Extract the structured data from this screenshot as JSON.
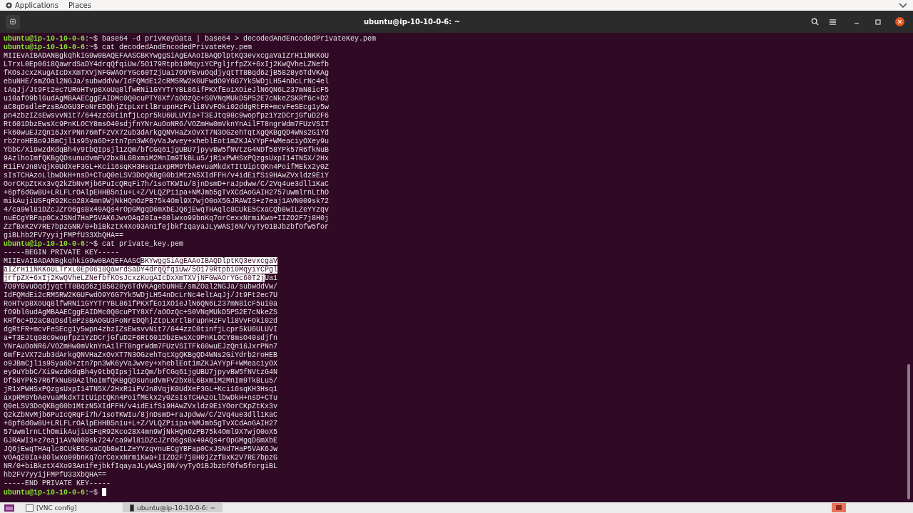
{
  "top_bar": {
    "menus": [
      "Applications",
      "Places"
    ]
  },
  "terminal": {
    "title": "ubuntu@ip-10-10-0-6: ~",
    "lines": [
      {
        "kind": "prompt",
        "user": "ubuntu@ip-10-10-0-6",
        "path": ":~$",
        "command": "base64 -d privKeyData | base64 > decodedAndEncodedPrivateKey.pem"
      },
      {
        "kind": "prompt",
        "user": "ubuntu@ip-10-10-0-6",
        "path": ":~$",
        "command": "cat decodedAndEncodedPrivateKey.pem"
      },
      {
        "kind": "output",
        "text": "MIIEvAIBADANBgkqhkiG9w0BAQEFAASCBKYwggSiAgEAAoIBAQDlptKQ3evxcgaVaIZrH1iNKKoU"
      },
      {
        "kind": "output",
        "text": "LTrxL0Ep0618QawrdSaDY4drqQfqiUw/5O179Rtpb10MqyiYCPgljrfpZX+6xIj2KwQVheLZNefb"
      },
      {
        "kind": "output",
        "text": "fKOsJcxzKugAIcDxXmTXVjNFGWAOrYGc60T2jUa17O9YBvuOqdjyqtTT8Bqd6zjB5828y6TdVKAg"
      },
      {
        "kind": "output",
        "text": "ebuNHE/smZOal2NGJa/subwddVw/IdFQMdEi2cRM5RW2KGUFwdO9Y6G7Yk5WDjLH54nDcLrNc4el"
      },
      {
        "kind": "output",
        "text": "tAqJj/Jt9Ft2ec7URoHTvp8XoUq8lfwRNi1GYYTrYBL86ifPKXfEo1XOieJlN6QN6L237mN8icF5"
      },
      {
        "kind": "output",
        "text": "ui0afO9blGudAgMBAAECggEAIDMc0Q0cuPTY8Xf/aOOzQc+S0VNqMUkD5P52E7cNkeZSKRf6c+D2"
      },
      {
        "kind": "output",
        "text": "aC8qDsdlePzsBAOGU3FoNrEDQhjZtpLxrtlBrupnHzFvli8VvFOki02ddgRtFR+mcvFeSEcg1y5w"
      },
      {
        "kind": "output",
        "text": "pn4zbzIZsEwsvvNit7/644zzC0tinfjLcpr5kU6ULUVIa+T3EJtq98c9wopfpz1YzDCrjGfuD2F6"
      },
      {
        "kind": "output",
        "text": "Rt601DbzEwsXc9PnKLOCY8msO40sdjfnYNrAuOoNR6/VOZmHw0mVknYnAilFT8ngrWdm7FUzVSIT"
      },
      {
        "kind": "output",
        "text": "Fk60wuEJzQn16JxrPNn76mfFzVX72ub3dArkgQNVHaZxOvXT7N3OGzehTqtXgQKBgQD4WNs2GiYd"
      },
      {
        "kind": "output",
        "text": "rb2roHEBo9JBmCjl1s95ya6D+ztn7pn3WK6yVaJwvey+xheblEot1mZKJAYYpF+WMeaciyOXey9u"
      },
      {
        "kind": "output",
        "text": "YbbC/Xi9wzdKdqBh4y9tbQIpsjl1zQm/bfCGq61jgUBU7jpyvBW5fNVtzG4NDf58YPk57R6fkNuB"
      },
      {
        "kind": "output",
        "text": "9AzlhoImfQKBgQDsunudvmFV2bx8L6BxmiM2MnIm9TkBLu5/jR1xPWHSxPQzgsUxpI14TN5X/2Hx"
      },
      {
        "kind": "output",
        "text": "R1iFVJn8VqjK0UdXeF3GL+Kci16sqKH3Hsq1axpRM9YbAevuaMkdxTItUiptQKn4PoifMEkx2y0Z"
      },
      {
        "kind": "output",
        "text": "sIsTCHAzoLlbwDkH+nsD+CTuQ0eLSV3DoQKBgG0b1MtzN5XIdFFH/v4idEifSi9HAwZVxldz9EiY"
      },
      {
        "kind": "output",
        "text": "OorCKpZtKx3vQ2kZbNvMjb6PuIcQRqFi7h/1soTKWIu/8jnDsmD+raJpdww/C/2Vq4ue3dll1KaC"
      },
      {
        "kind": "output",
        "text": "+6pf6dGw8U+LRLFLrOAlpEHHB5niu+L+Z/VLQZPiipa+NMJmb5gTvXCdAoGAIH2757uwmlrnLthO"
      },
      {
        "kind": "output",
        "text": "mikAujiUSFqR92Kco28X4mn9WjNkHQnOzPB75k4Oml9X7wjO0oX5GJRAWI3+z7eaj1AVN009sk72"
      },
      {
        "kind": "output",
        "text": "4/ca9Wl81DZcJZrO6gsBx49AQs4rOpGMgqD6mXbEJQ6jEwqTHAqlc8CUkE5CxaCQb8wILZeYYzqv"
      },
      {
        "kind": "output",
        "text": "nuECgYBFap0CxJSNd7HaP5VAK6JwvOAq20Ia+80lwxo99bnKq7orCexxNrmiKwa+IIZO2F7j8H0j"
      },
      {
        "kind": "output",
        "text": "ZzfBxK2V7RE7bpzGNR/0+biBkztX4Xo93An1fejbkfIqayaJLyWASj6N/vyTyO1BJbzbfOfw5for"
      },
      {
        "kind": "output",
        "text": "giBLhb2FV7yyijFMPfU33XbQHA=="
      },
      {
        "kind": "prompt",
        "user": "ubuntu@ip-10-10-0-6",
        "path": ":~$",
        "command": "cat private_key.pem"
      },
      {
        "kind": "output",
        "text": "-----BEGIN PRIVATE KEY-----"
      },
      {
        "kind": "segments",
        "segments": [
          {
            "text": "MIIEvAIBADANBgkqhkiG9w0BAQEFAASC",
            "selected": false
          },
          {
            "text": "BKYwggSiAgEAAoIBAQDlptKQ3evxcgaV",
            "selected": true
          }
        ]
      },
      {
        "kind": "segments",
        "segments": [
          {
            "text": "aIZrH1iNKKoULTrxL0Ep0618QawrdSaDY4drqQfqiUw/5O179Rtpb10MqyiYCPgl",
            "selected": true
          }
        ]
      },
      {
        "kind": "segments",
        "segments": [
          {
            "text": "jrfpZX+6xIj2KwQVheLZNefbfKOsJcxzKugAIcDxXmTXVjNFGWAOrYGc60T2j",
            "selected": true
          },
          {
            "text": "Ua1",
            "selected": false
          }
        ]
      },
      {
        "kind": "output",
        "text": "7O9YBvuOqdjyqtTT8Bqd6zjB5828y6TdVKAgebuNHE/smZOal2NGJa/subwddVw/"
      },
      {
        "kind": "output",
        "text": "IdFQMdEi2cRM5RW2KGUFwdO9Y6G7Yk5WDjLH54nDcLrNc4eltAqJj/Jt9Ft2ec7U"
      },
      {
        "kind": "output",
        "text": "RoHTvp8XoUq8lfwRNi1GYYTrYBL86ifPKXfEo1XOieJlN6QN6L237mN8icF5ui0a"
      },
      {
        "kind": "output",
        "text": "fO9blGudAgMBAAECggEAIDMc0Q0cuPTY8Xf/aOOzQc+S0VNqMUkD5P52E7cNkeZS"
      },
      {
        "kind": "output",
        "text": "KRf6c+D2aC8qDsdlePzsBAOGU3FoNrEDQhjZtpLxrtlBrupnHzFvli8VvFOki02d"
      },
      {
        "kind": "output",
        "text": "dgRtFR+mcvFeSEcg1y5wpn4zbzIZsEwsvvNit7/644zzC0tinfjLcpr5kU6ULUVI"
      },
      {
        "kind": "output",
        "text": "a+T3EJtq98c9wopfpz1YzDCrjGfuD2F6Rt601DbzEwsXc9PnKLOCY8msO40sdjfn"
      },
      {
        "kind": "output",
        "text": "YNrAuOoNR6/VOZmHw0mVknYnAilFT8ngrWdm7FUzVSITFk60wuEJzQn16JxrPNn7"
      },
      {
        "kind": "output",
        "text": "6mfFzVX72ub3dArkgQNVHaZxOvXT7N3OGzehTqtXgQKBgQD4WNs2GiYdrb2roHEB"
      },
      {
        "kind": "output",
        "text": "o9JBmCjl1s95ya6D+ztn7pn3WK6yVaJwvey+xheblEot1mZKJAYYpF+WMeaciyOX"
      },
      {
        "kind": "output",
        "text": "ey9uYbbC/Xi9wzdKdqBh4y9tbQIpsjl1zQm/bfCGq61jgUBU7jpyvBW5fNVtzG4N"
      },
      {
        "kind": "output",
        "text": "Df58YPk57R6fkNuB9AzlhoImfQKBgQDsunudvmFV2bx8L6BxmiM2MnIm9TkBLu5/"
      },
      {
        "kind": "output",
        "text": "jR1xPWHSxPQzgsUxpI14TN5X/2HxR1iFVJn8VqjK0UdXeF3GL+Kci16sqKH3Hsq1"
      },
      {
        "kind": "output",
        "text": "axpRM9YbAevuaMkdxTItUiptQKn4PoifMEkx2y0ZsIsTCHAzoLlbwDkH+nsD+CTu"
      },
      {
        "kind": "output",
        "text": "Q0eLSV3DoQKBgG0b1MtzN5XIdFFH/v4idEifSi9HAwZVxldz9EiYOorCKpZtKx3v"
      },
      {
        "kind": "output",
        "text": "Q2kZbNvMjb6PuIcQRqFi7h/1soTKWIu/8jnDsmD+raJpdww/C/2Vq4ue3dll1KaC"
      },
      {
        "kind": "output",
        "text": "+6pf6dGw8U+LRLFLrOAlpEHHB5niu+L+Z/VLQZPiipa+NMJmb5gTvXCdAoGAIH27"
      },
      {
        "kind": "output",
        "text": "57uwmlrnLthOmikAujiUSFqR92Kco28X4mn9WjNkHQnOzPB75k4Oml9X7wjO0oX5"
      },
      {
        "kind": "output",
        "text": "GJRAWI3+z7eaj1AVN009sk724/ca9Wl81DZcJZrO6gsBx49AQs4rOpGMgqD6mXbE"
      },
      {
        "kind": "output",
        "text": "JQ6jEwqTHAqlc8CUkE5CxaCQb8wILZeYYzqvnuECgYBFap0CxJSNd7HaP5VAK6Jw"
      },
      {
        "kind": "output",
        "text": "vOAq20Ia+80lwxo99bnKq7orCexxNrmiKwa+IIZO2F7j8H0jZzfBxK2V7RE7bpzG"
      },
      {
        "kind": "output",
        "text": "NR/0+biBkztX4Xo93An1fejbkfIqayaJLyWASj6N/vyTyO1BJbzbfOfw5forgiBL"
      },
      {
        "kind": "output",
        "text": "hb2FV7yyijFMPfU33XbQHA=="
      },
      {
        "kind": "output",
        "text": "-----END PRIVATE KEY-----"
      },
      {
        "kind": "prompt",
        "user": "ubuntu@ip-10-10-0-6",
        "path": ":~$",
        "cursor": true
      }
    ]
  },
  "taskbar": {
    "items": [
      {
        "label": "[VNC config]",
        "selected": false
      },
      {
        "label": "ubuntu@ip-10-10-0-6: ~",
        "selected": true
      }
    ]
  }
}
